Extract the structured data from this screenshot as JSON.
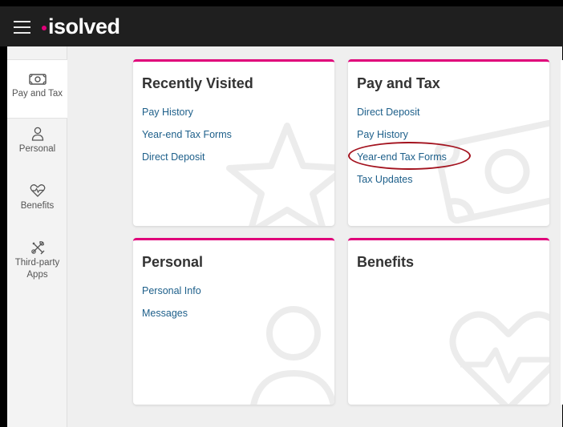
{
  "app": {
    "brand": "isolved",
    "accent": "#e0007a",
    "link_color": "#1d5f8a"
  },
  "sidebar": {
    "items": [
      {
        "label": "Pay and Tax",
        "icon": "money-icon",
        "active": true
      },
      {
        "label": "Personal",
        "icon": "person-icon",
        "active": false
      },
      {
        "label": "Benefits",
        "icon": "heart-pulse-icon",
        "active": false
      },
      {
        "label": "Third-party Apps",
        "label_line1": "Third-party",
        "label_line2": "Apps",
        "icon": "tools-icon",
        "active": false
      }
    ]
  },
  "cards": {
    "recent": {
      "title": "Recently Visited",
      "links": [
        "Pay History",
        "Year-end Tax Forms",
        "Direct Deposit"
      ],
      "watermark": "star-icon"
    },
    "paytax": {
      "title": "Pay and Tax",
      "links": [
        "Direct Deposit",
        "Pay History",
        "Year-end Tax Forms",
        "Tax Updates"
      ],
      "watermark": "money-icon",
      "highlighted_link": "Year-end Tax Forms"
    },
    "personal": {
      "title": "Personal",
      "links": [
        "Personal Info",
        "Messages"
      ],
      "watermark": "person-icon"
    },
    "benefits": {
      "title": "Benefits",
      "links": [],
      "watermark": "heart-pulse-icon"
    }
  }
}
